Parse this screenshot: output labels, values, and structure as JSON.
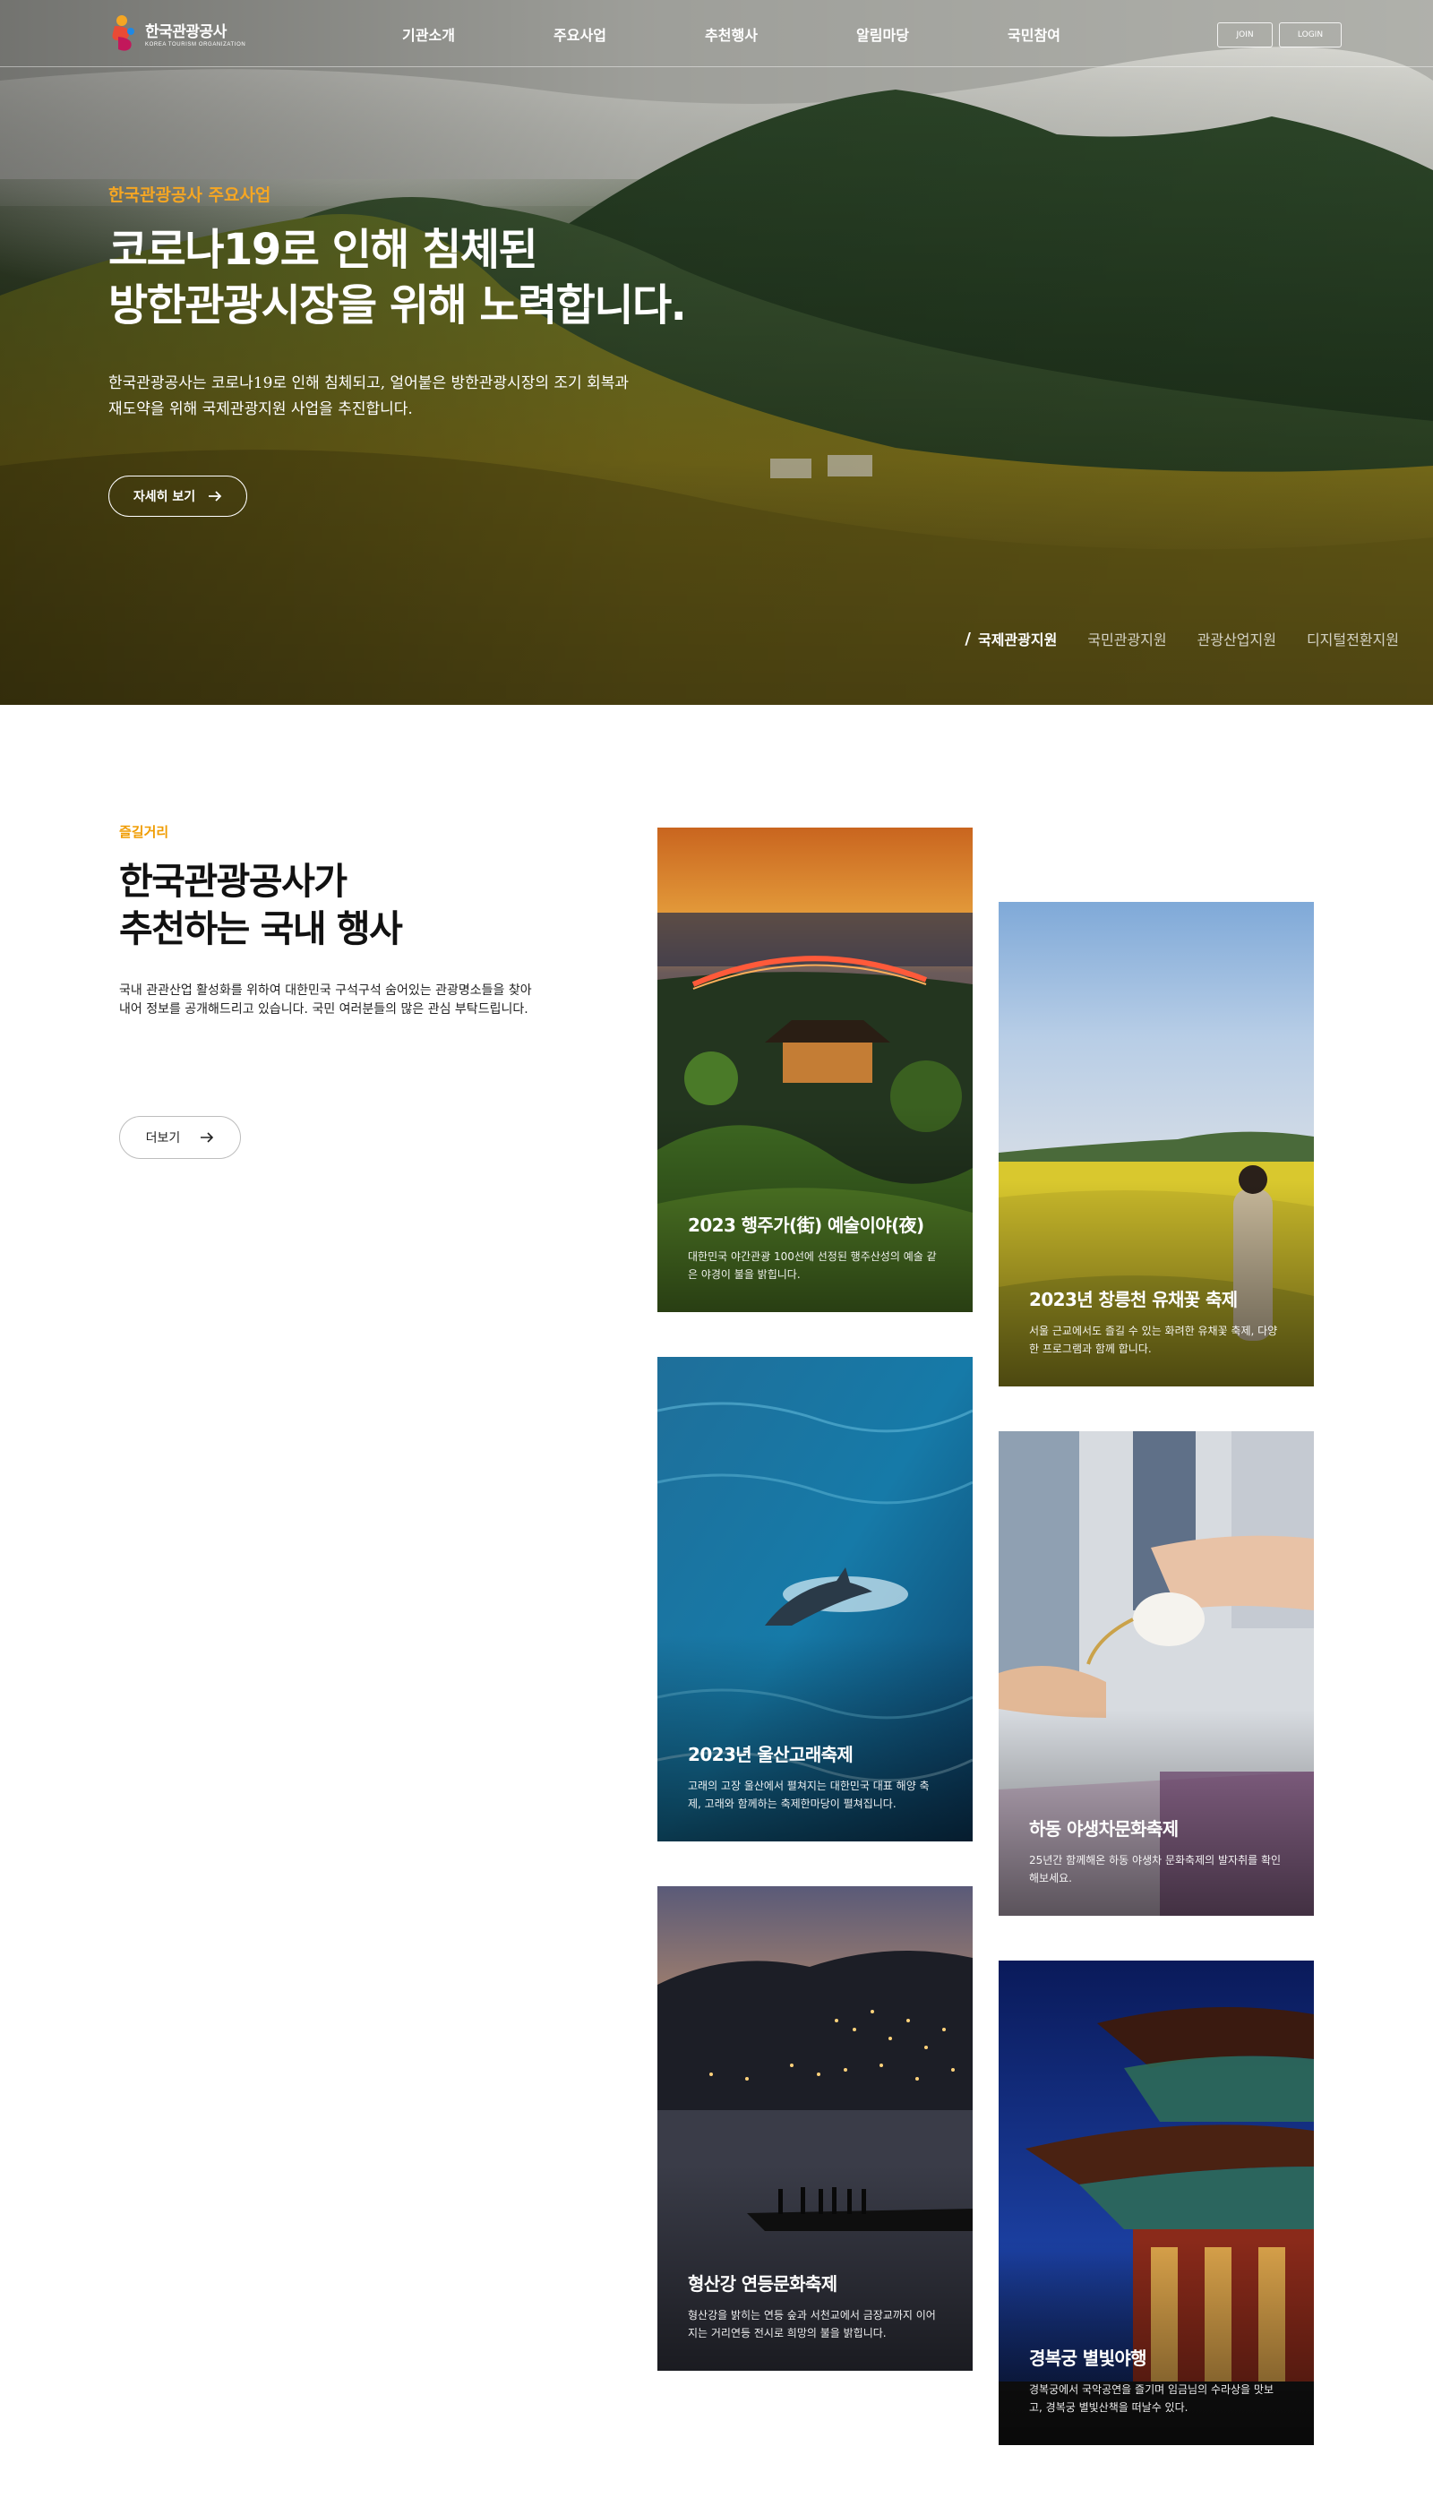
{
  "header": {
    "logo_kr": "한국관광공사",
    "logo_en": "KOREA TOURISM ORGANIZATION",
    "nav": [
      "기관소개",
      "주요사업",
      "추천행사",
      "알림마당",
      "국민참여"
    ],
    "join_label": "JOIN",
    "login_label": "LOGIN"
  },
  "hero": {
    "eyebrow": "한국관광공사 주요사업",
    "title_line1": "코로나19로 인해 침체된",
    "title_line2": "방한관광시장을 위해 노력합니다.",
    "desc_line1": "한국관광공사는 코로나19로 인해 침체되고, 얼어붙은 방한관광시장의 조기 회복과",
    "desc_line2": "재도약을 위해 국제관광지원 사업을 추진합니다.",
    "button_label": "자세히 보기",
    "tabs": [
      "국제관광지원",
      "국민관광지원",
      "관광산업지원",
      "디지털전환지원"
    ],
    "active_tab": "국제관광지원",
    "accent_color": "#f5a623"
  },
  "festival": {
    "eyebrow": "즐길거리",
    "title_line1": "한국관광공사가",
    "title_line2": "추천하는 국내 행사",
    "desc": "국내 관관산업 활성화를 위하여 대한민국 구석구석 숨어있는 관광명소들을 찾아내어 정보를 공개해드리고 있습니다. 국민 여러분들의 많은 관심 부탁드립니다.",
    "more_label": "더보기",
    "eyebrow_color": "#f09c00",
    "cards": [
      {
        "title": "2023 행주가(街) 예술이야(夜)",
        "desc": "대한민국 야간관광 100선에 선정된 행주산성의 예술 같은 야경이 불을 밝힙니다."
      },
      {
        "title": "2023년 창릉천 유채꽃 축제",
        "desc": "서울 근교에서도 즐길 수 있는 화려한 유채꽃 축제, 다양한 프로그램과 함께 합니다."
      },
      {
        "title": "2023년 울산고래축제",
        "desc": "고래의 고장 울산에서 펼쳐지는 대한민국 대표 해양 축제, 고래와 함께하는 축제한마당이 펼쳐집니다."
      },
      {
        "title": "하동 야생차문화축제",
        "desc": "25년간 함께해온 하동 야생차 문화축제의 발자취를 확인해보세요."
      },
      {
        "title": "형산강 연등문화축제",
        "desc": "형산강을 밝히는 연등 숲과 서천교에서 금장교까지 이어지는 거리연등 전시로 희망의 불을 밝힙니다."
      },
      {
        "title": "경복궁 별빛야행",
        "desc": "경복궁에서 국악공연을 즐기며 임금님의 수라상을 맛보고, 경복궁 별빛산책을 떠날수 있다."
      }
    ]
  }
}
